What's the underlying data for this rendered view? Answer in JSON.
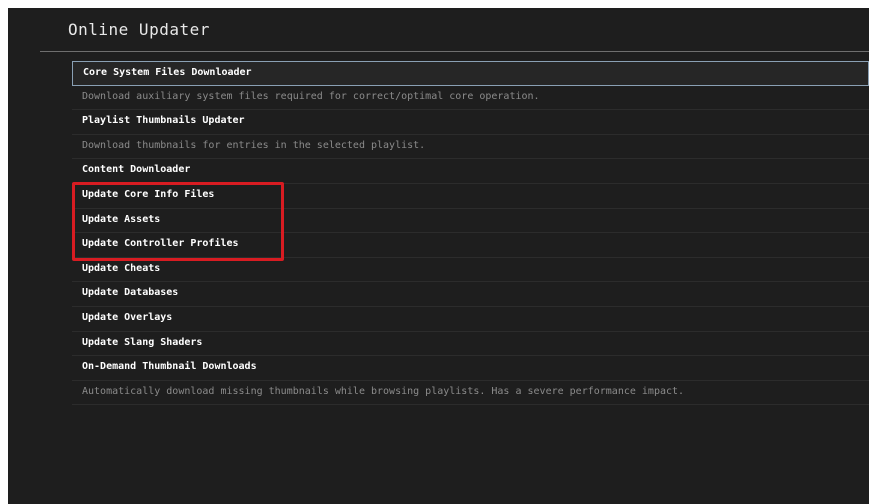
{
  "header": {
    "title": "Online Updater"
  },
  "menu": {
    "rows": [
      {
        "label": "Core System Files Downloader"
      },
      {
        "label": "Download auxiliary system files required for correct/optimal core operation."
      },
      {
        "label": "Playlist Thumbnails Updater"
      },
      {
        "label": "Download thumbnails for entries in the selected playlist."
      },
      {
        "label": "Content Downloader"
      },
      {
        "label": "Update Core Info Files"
      },
      {
        "label": "Update Assets"
      },
      {
        "label": "Update Controller Profiles"
      },
      {
        "label": "Update Cheats"
      },
      {
        "label": "Update Databases"
      },
      {
        "label": "Update Overlays"
      },
      {
        "label": "Update Slang Shaders"
      },
      {
        "label": "On-Demand Thumbnail Downloads"
      },
      {
        "label": "Automatically download missing thumbnails while browsing playlists. Has a severe performance impact."
      }
    ]
  },
  "colors": {
    "background": "#1e1e1e",
    "text": "#ffffff",
    "description": "#8b8b8b",
    "highlight_box": "#d81c22",
    "selection_border": "#8aa0b4"
  }
}
